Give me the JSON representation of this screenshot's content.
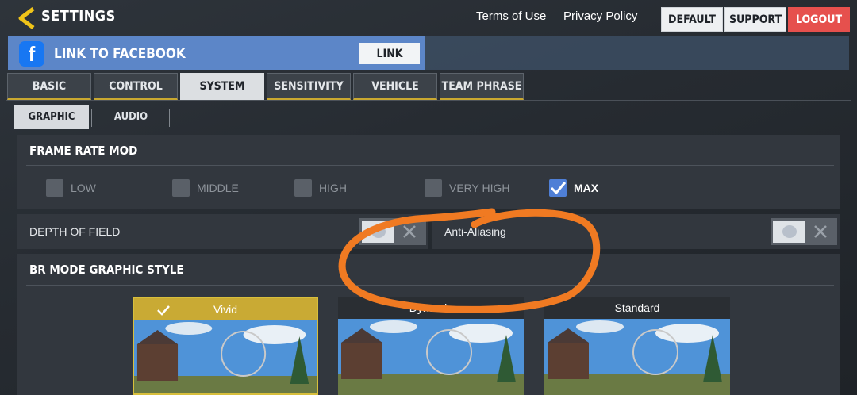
{
  "header": {
    "title": "SETTINGS",
    "links": [
      "Terms of Use",
      "Privacy Policy"
    ],
    "buttons": [
      "DEFAULT",
      "SUPPORT",
      "LOGOUT"
    ]
  },
  "facebook": {
    "icon_letter": "f",
    "label": "LINK TO FACEBOOK",
    "button": "LINK"
  },
  "tabs": [
    "BASIC",
    "CONTROL",
    "SYSTEM",
    "SENSITIVITY",
    "VEHICLE",
    "TEAM PHRASE"
  ],
  "active_tab": "SYSTEM",
  "subtabs": [
    "GRAPHIC",
    "AUDIO"
  ],
  "active_subtab": "GRAPHIC",
  "frame_rate": {
    "title": "FRAME RATE MOD",
    "options": [
      "LOW",
      "MIDDLE",
      "HIGH",
      "VERY HIGH",
      "MAX"
    ],
    "selected": "MAX"
  },
  "toggles": {
    "depth_of_field": {
      "label": "DEPTH OF FIELD",
      "on": false
    },
    "anti_aliasing": {
      "label": "Anti-Aliasing",
      "on": false
    }
  },
  "graphic_style": {
    "title": "BR MODE GRAPHIC STYLE",
    "options": [
      "Vivid",
      "Dynamic",
      "Standard"
    ],
    "selected": "Vivid"
  },
  "colors": {
    "accent_gold": "#c9aa34",
    "facebook_blue": "#5c86c8",
    "logout_red": "#e6504d",
    "checkbox_blue": "#4f7fd6",
    "annotation_orange": "#f07a22"
  },
  "icons": [
    "back-chevron-icon",
    "facebook-icon",
    "check-icon",
    "close-icon"
  ]
}
